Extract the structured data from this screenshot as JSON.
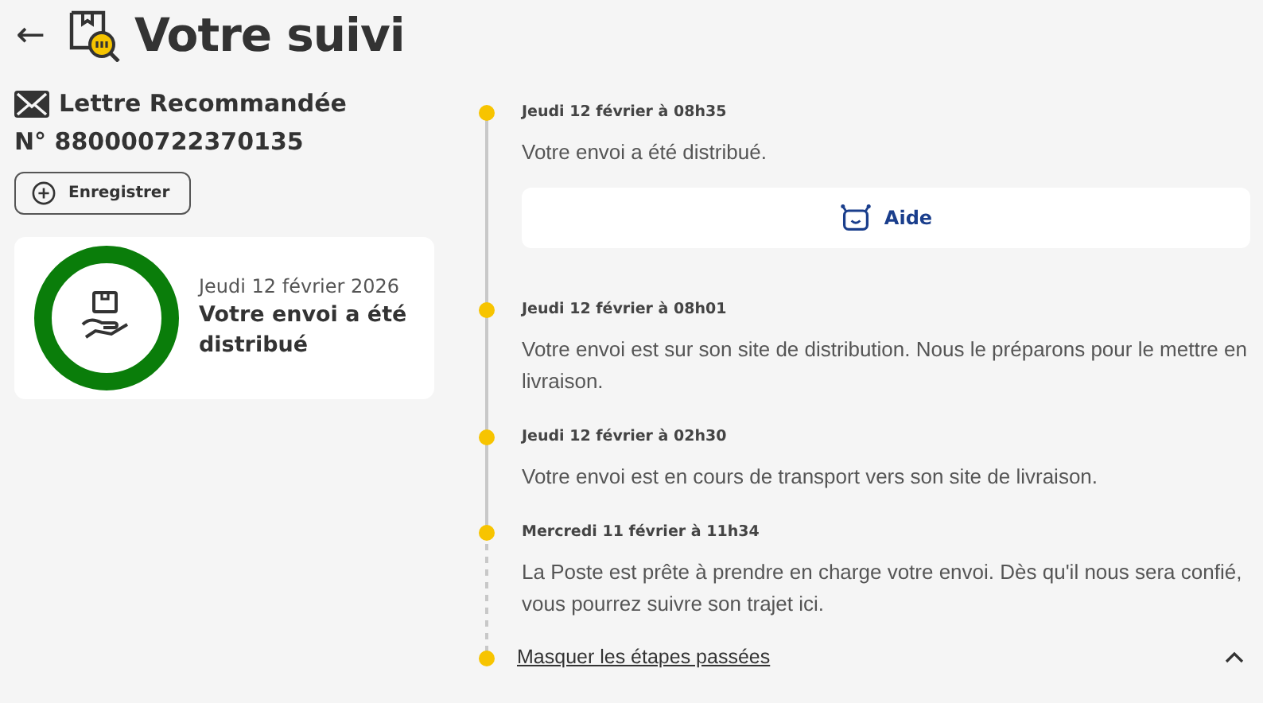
{
  "header": {
    "back": "←",
    "title": "Votre suivi"
  },
  "shipment": {
    "type": "Lettre Recommandée",
    "number": "N° 880000722370135",
    "save_button": "Enregistrer"
  },
  "status_card": {
    "date": "Jeudi 12 février 2026",
    "status": "Votre envoi a été distribué"
  },
  "events": [
    {
      "date": "Jeudi 12 février à 08h35",
      "text": "Votre envoi a été distribué.",
      "help_button": "Aide",
      "done": true
    },
    {
      "date": "Jeudi 12 février à 08h01",
      "text": "Votre envoi est sur son site de distribution. Nous le préparons pour le mettre en livraison.",
      "done": true
    },
    {
      "date": "Jeudi 12 février à 02h30",
      "text": "Votre envoi est en cours de transport vers son site de livraison.",
      "done": true
    },
    {
      "date": "Mercredi 11 février à 11h34",
      "text": "La Poste est prête à prendre en charge votre envoi. Dès qu'il nous sera confié, vous pourrez suivre son trajet ici.",
      "done": false
    }
  ],
  "toggle": {
    "label": "Masquer les étapes passées",
    "expanded": true
  }
}
